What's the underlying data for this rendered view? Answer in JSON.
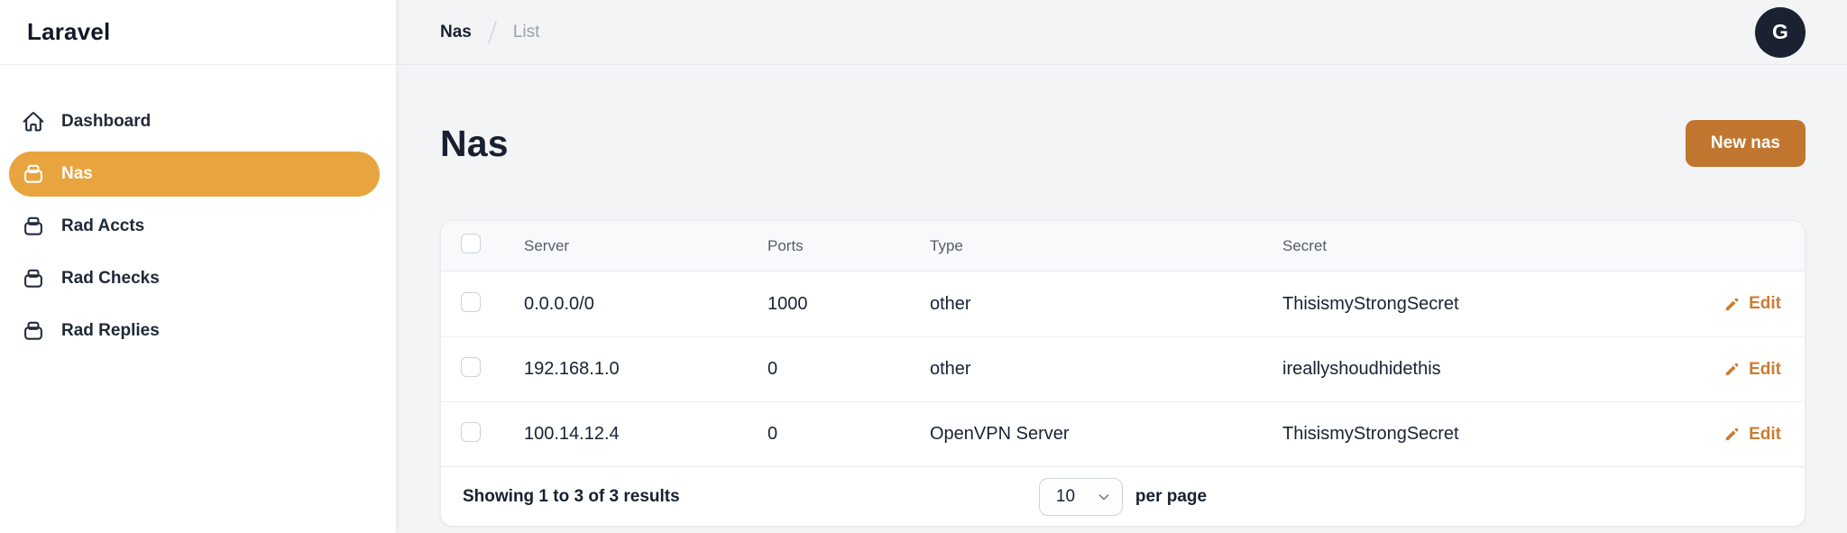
{
  "app": {
    "logo": "Laravel"
  },
  "colors": {
    "sidebar_active_pill": "#e8a43e",
    "primary_button": "#c1762f",
    "edit_link": "#cc7c33",
    "avatar_bg": "#1a2232",
    "main_background": "#f3f4f6"
  },
  "sidebar": {
    "items": [
      {
        "label": "Dashboard",
        "icon": "home-icon",
        "active": false
      },
      {
        "label": "Nas",
        "icon": "archive-box-icon",
        "active": true
      },
      {
        "label": "Rad Accts",
        "icon": "archive-box-icon",
        "active": false
      },
      {
        "label": "Rad Checks",
        "icon": "archive-box-icon",
        "active": false
      },
      {
        "label": "Rad Replies",
        "icon": "archive-box-icon",
        "active": false
      }
    ]
  },
  "header": {
    "breadcrumb": [
      "Nas",
      "List"
    ],
    "avatar_initial": "G"
  },
  "page": {
    "title": "Nas",
    "new_button": "New nas"
  },
  "table": {
    "columns": [
      "Server",
      "Ports",
      "Type",
      "Secret"
    ],
    "edit_label": "Edit",
    "rows": [
      {
        "server": "0.0.0.0/0",
        "ports": "1000",
        "type": "other",
        "secret": "ThisismyStrongSecret"
      },
      {
        "server": "192.168.1.0",
        "ports": "0",
        "type": "other",
        "secret": "ireallyshoudhidethis"
      },
      {
        "server": "100.14.12.4",
        "ports": "0",
        "type": "OpenVPN Server",
        "secret": "ThisismyStrongSecret"
      }
    ],
    "footer": {
      "summary": "Showing 1 to 3 of 3 results",
      "per_page_value": "10",
      "per_page_label": "per page"
    }
  }
}
